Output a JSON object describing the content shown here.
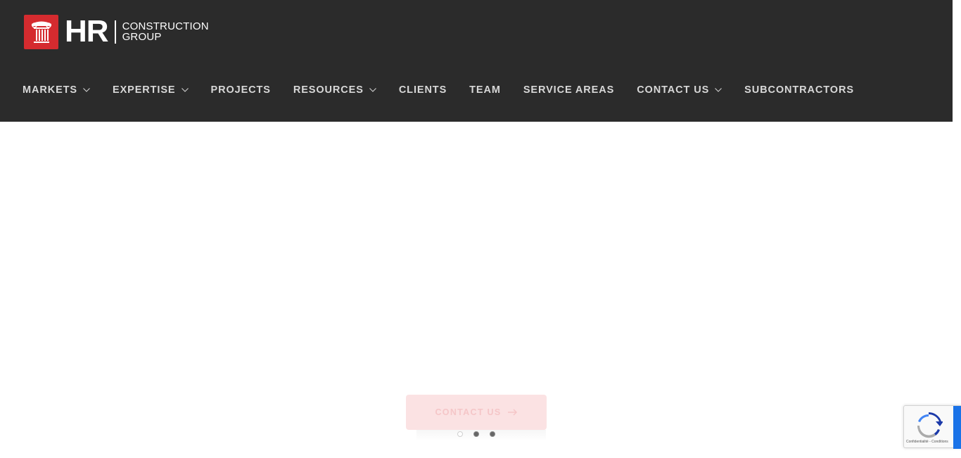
{
  "brand": {
    "logo_hr": "HR",
    "logo_line1": "CONSTRUCTION",
    "logo_line2": "GROUP",
    "accent_color": "#d52b2f",
    "header_bg": "#2b2b2b"
  },
  "nav": {
    "items": [
      {
        "label": "MARKETS",
        "has_dropdown": true
      },
      {
        "label": "EXPERTISE",
        "has_dropdown": true
      },
      {
        "label": "PROJECTS",
        "has_dropdown": false
      },
      {
        "label": "RESOURCES",
        "has_dropdown": true
      },
      {
        "label": "CLIENTS",
        "has_dropdown": false
      },
      {
        "label": "TEAM",
        "has_dropdown": false
      },
      {
        "label": "SERVICE AREAS",
        "has_dropdown": false
      },
      {
        "label": "CONTACT US",
        "has_dropdown": true
      },
      {
        "label": "SUBCONTRACTORS",
        "has_dropdown": false
      }
    ],
    "dropdown_icon": "chevron-down-icon"
  },
  "hero": {
    "cta_label": "CONTACT US",
    "cta_icon": "arrow-right-icon",
    "slider": {
      "total": 3,
      "active": [
        2,
        3
      ]
    }
  },
  "recaptcha": {
    "links": "Confidentialité - Conditions"
  }
}
